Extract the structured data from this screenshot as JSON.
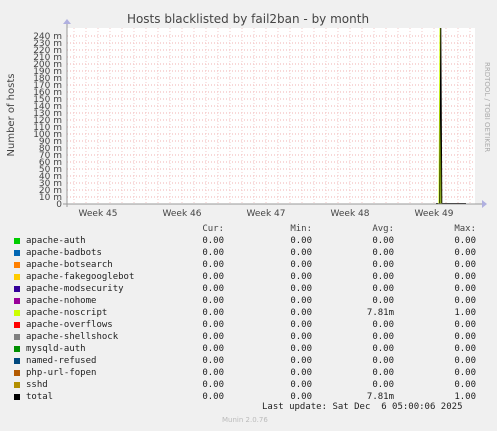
{
  "chart_data": {
    "type": "line",
    "title": "Hosts blacklisted by fail2ban - by month",
    "ylabel": "Number of hosts",
    "xlabel": "",
    "x_ticks": [
      "Week 45",
      "Week 46",
      "Week 47",
      "Week 48",
      "Week 49"
    ],
    "y_ticks": [
      "0",
      "10 m",
      "20 m",
      "30 m",
      "40 m",
      "50 m",
      "60 m",
      "70 m",
      "80 m",
      "90 m",
      "100 m",
      "110 m",
      "120 m",
      "130 m",
      "140 m",
      "150 m",
      "160 m",
      "170 m",
      "180 m",
      "190 m",
      "200 m",
      "210 m",
      "220 m",
      "230 m",
      "240 m"
    ],
    "ylim": [
      0,
      0.25
    ],
    "grid": true,
    "spike": {
      "x_week": 49.1,
      "y": 1.0,
      "series": [
        "apache-noscript",
        "total"
      ]
    }
  },
  "side_label": "RRDTOOL / TOBI OETIKER",
  "legend": {
    "headers": {
      "cur": "Cur:",
      "min": "Min:",
      "avg": "Avg:",
      "max": "Max:"
    },
    "rows": [
      {
        "name": "apache-auth",
        "color": "#00cc00",
        "cur": "0.00",
        "min": "0.00",
        "avg": "0.00",
        "max": "0.00"
      },
      {
        "name": "apache-badbots",
        "color": "#0066b3",
        "cur": "0.00",
        "min": "0.00",
        "avg": "0.00",
        "max": "0.00"
      },
      {
        "name": "apache-botsearch",
        "color": "#ff8000",
        "cur": "0.00",
        "min": "0.00",
        "avg": "0.00",
        "max": "0.00"
      },
      {
        "name": "apache-fakegooglebot",
        "color": "#ffcc00",
        "cur": "0.00",
        "min": "0.00",
        "avg": "0.00",
        "max": "0.00"
      },
      {
        "name": "apache-modsecurity",
        "color": "#330099",
        "cur": "0.00",
        "min": "0.00",
        "avg": "0.00",
        "max": "0.00"
      },
      {
        "name": "apache-nohome",
        "color": "#990099",
        "cur": "0.00",
        "min": "0.00",
        "avg": "0.00",
        "max": "0.00"
      },
      {
        "name": "apache-noscript",
        "color": "#ccff00",
        "cur": "0.00",
        "min": "0.00",
        "avg": "7.81m",
        "max": "1.00"
      },
      {
        "name": "apache-overflows",
        "color": "#ff0000",
        "cur": "0.00",
        "min": "0.00",
        "avg": "0.00",
        "max": "0.00"
      },
      {
        "name": "apache-shellshock",
        "color": "#808080",
        "cur": "0.00",
        "min": "0.00",
        "avg": "0.00",
        "max": "0.00"
      },
      {
        "name": "mysqld-auth",
        "color": "#008f00",
        "cur": "0.00",
        "min": "0.00",
        "avg": "0.00",
        "max": "0.00"
      },
      {
        "name": "named-refused",
        "color": "#00487d",
        "cur": "0.00",
        "min": "0.00",
        "avg": "0.00",
        "max": "0.00"
      },
      {
        "name": "php-url-fopen",
        "color": "#b35a00",
        "cur": "0.00",
        "min": "0.00",
        "avg": "0.00",
        "max": "0.00"
      },
      {
        "name": "sshd",
        "color": "#b38f00",
        "cur": "0.00",
        "min": "0.00",
        "avg": "0.00",
        "max": "0.00"
      },
      {
        "name": "total",
        "color": "#000000",
        "cur": "0.00",
        "min": "0.00",
        "avg": "7.81m",
        "max": "1.00"
      }
    ]
  },
  "last_update": "Last update: Sat Dec  6 05:00:06 2025",
  "footer": "Munin 2.0.76"
}
